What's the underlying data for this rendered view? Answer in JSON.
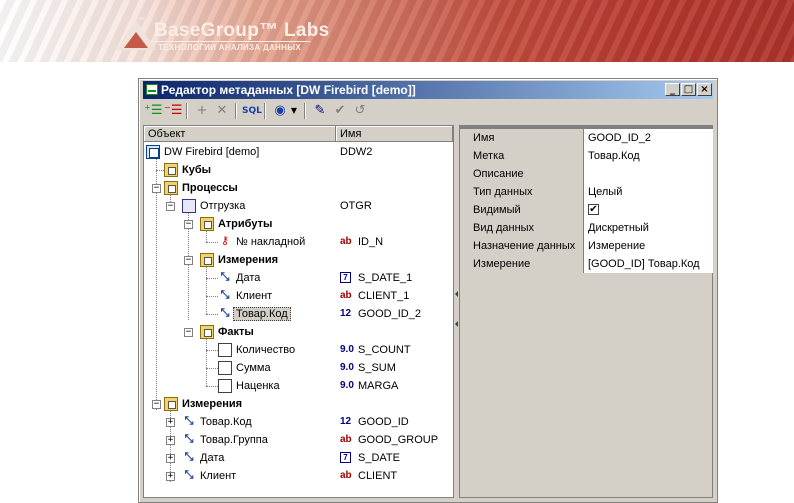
{
  "banner": {
    "logo_tm_left": "™",
    "logo_name": "BaseGroup™ Labs",
    "logo_tagline": "ТЕХНОЛОГИИ АНАЛИЗА ДАННЫХ"
  },
  "window": {
    "title": "Редактор метаданных [DW Firebird [demo]]",
    "controls": [
      "_",
      "□",
      "×"
    ]
  },
  "toolbar": {
    "icons": [
      "add-item-icon",
      "remove-item-icon",
      "add-icon",
      "delete-icon",
      "sql-icon",
      "connect-icon",
      "dropdown-icon",
      "edit-icon",
      "apply-icon",
      "undo-icon"
    ]
  },
  "tree": {
    "col_object": "Объект",
    "col_name": "Имя",
    "rows": [
      {
        "label": "DW Firebird [demo]",
        "name": "DDW2"
      },
      {
        "label": "Кубы",
        "name": ""
      },
      {
        "label": "Процессы",
        "name": ""
      },
      {
        "label": "Отгрузка",
        "name": "OTGR"
      },
      {
        "label": "Атрибуты",
        "name": ""
      },
      {
        "label": "№ накладной",
        "type": "ab",
        "name": "ID_N"
      },
      {
        "label": "Измерения",
        "name": ""
      },
      {
        "label": "Дата",
        "type": "7",
        "name": "S_DATE_1"
      },
      {
        "label": "Клиент",
        "type": "ab",
        "name": "CLIENT_1"
      },
      {
        "label": "Товар.Код",
        "type": "12",
        "name": "GOOD_ID_2"
      },
      {
        "label": "Факты",
        "name": ""
      },
      {
        "label": "Количество",
        "type": "9.0",
        "name": "S_COUNT"
      },
      {
        "label": "Сумма",
        "type": "9.0",
        "name": "S_SUM"
      },
      {
        "label": "Наценка",
        "type": "9.0",
        "name": "MARGA"
      },
      {
        "label": "Измерения",
        "name": ""
      },
      {
        "label": "Товар.Код",
        "type": "12",
        "name": "GOOD_ID"
      },
      {
        "label": "Товар.Группа",
        "type": "ab",
        "name": "GOOD_GROUP"
      },
      {
        "label": "Дата",
        "type": "7",
        "name": "S_DATE"
      },
      {
        "label": "Клиент",
        "type": "ab",
        "name": "CLIENT"
      }
    ]
  },
  "properties": [
    {
      "key": "Имя",
      "value": "GOOD_ID_2"
    },
    {
      "key": "Метка",
      "value": "Товар.Код"
    },
    {
      "key": "Описание",
      "value": ""
    },
    {
      "key": "Тип данных",
      "value": "Целый"
    },
    {
      "key": "Видимый",
      "value": "",
      "checked": true
    },
    {
      "key": "Вид данных",
      "value": "Дискретный"
    },
    {
      "key": "Назначение данных",
      "value": "Измерение"
    },
    {
      "key": "Измерение",
      "value": "[GOOD_ID] Товар.Код"
    }
  ],
  "colors": {
    "title_start": "#0a246a",
    "title_end": "#a6caf0",
    "type_text": "#9a0000",
    "type_num": "#000080"
  }
}
